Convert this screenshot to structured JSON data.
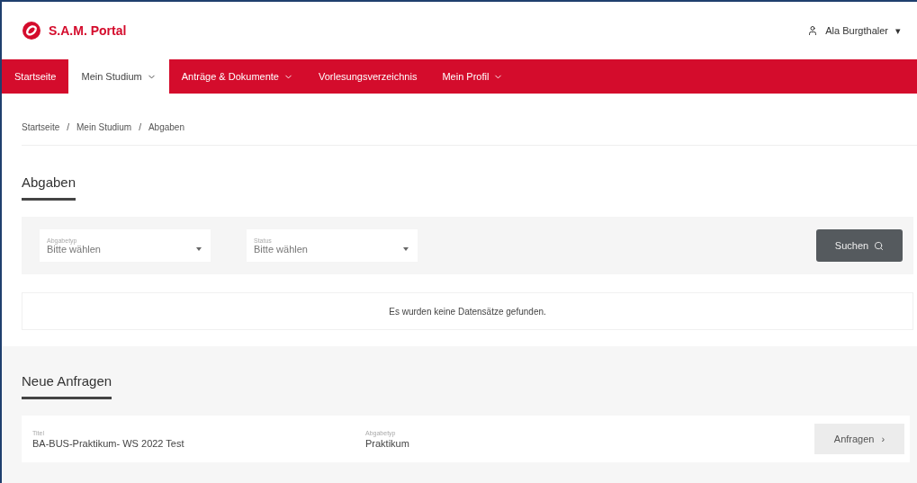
{
  "header": {
    "logo_text": "S.A.M. Portal",
    "user": "Ala Burgthaler",
    "user_caret": "▾"
  },
  "nav": [
    {
      "label": "Startseite",
      "selected": false,
      "dropdown": false
    },
    {
      "label": "Mein Studium",
      "selected": true,
      "dropdown": true
    },
    {
      "label": "Anträge & Dokumente",
      "selected": false,
      "dropdown": true
    },
    {
      "label": "Vorlesungsverzeichnis",
      "selected": false,
      "dropdown": false
    },
    {
      "label": "Mein Profil",
      "selected": false,
      "dropdown": true
    }
  ],
  "breadcrumb": [
    "Startseite",
    "Mein Studium",
    "Abgaben"
  ],
  "breadcrumb_separator": "/",
  "abgaben": {
    "title": "Abgaben",
    "filters": [
      {
        "label": "Abgabetyp",
        "placeholder": "Bitte wählen"
      },
      {
        "label": "Status",
        "placeholder": "Bitte wählen"
      }
    ],
    "search_button": "Suchen",
    "empty_message": "Es wurden keine Datensätze gefunden."
  },
  "neue_anfragen": {
    "title": "Neue Anfragen",
    "rows": [
      {
        "fields": [
          {
            "label": "Titel",
            "value": "BA-BUS-Praktikum- WS 2022 Test"
          },
          {
            "label": "Abgabetyp",
            "value": "Praktikum"
          }
        ],
        "button": "Anfragen",
        "button_icon": "›"
      }
    ]
  }
}
